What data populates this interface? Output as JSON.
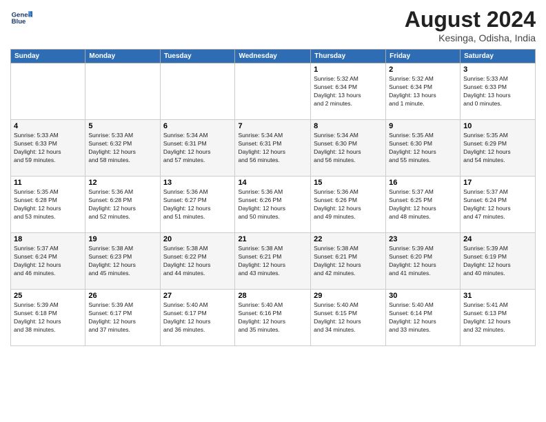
{
  "header": {
    "logo_line1": "General",
    "logo_line2": "Blue",
    "month": "August 2024",
    "location": "Kesinga, Odisha, India"
  },
  "days_of_week": [
    "Sunday",
    "Monday",
    "Tuesday",
    "Wednesday",
    "Thursday",
    "Friday",
    "Saturday"
  ],
  "weeks": [
    [
      {
        "day": "",
        "info": ""
      },
      {
        "day": "",
        "info": ""
      },
      {
        "day": "",
        "info": ""
      },
      {
        "day": "",
        "info": ""
      },
      {
        "day": "1",
        "info": "Sunrise: 5:32 AM\nSunset: 6:34 PM\nDaylight: 13 hours\nand 2 minutes."
      },
      {
        "day": "2",
        "info": "Sunrise: 5:32 AM\nSunset: 6:34 PM\nDaylight: 13 hours\nand 1 minute."
      },
      {
        "day": "3",
        "info": "Sunrise: 5:33 AM\nSunset: 6:33 PM\nDaylight: 13 hours\nand 0 minutes."
      }
    ],
    [
      {
        "day": "4",
        "info": "Sunrise: 5:33 AM\nSunset: 6:33 PM\nDaylight: 12 hours\nand 59 minutes."
      },
      {
        "day": "5",
        "info": "Sunrise: 5:33 AM\nSunset: 6:32 PM\nDaylight: 12 hours\nand 58 minutes."
      },
      {
        "day": "6",
        "info": "Sunrise: 5:34 AM\nSunset: 6:31 PM\nDaylight: 12 hours\nand 57 minutes."
      },
      {
        "day": "7",
        "info": "Sunrise: 5:34 AM\nSunset: 6:31 PM\nDaylight: 12 hours\nand 56 minutes."
      },
      {
        "day": "8",
        "info": "Sunrise: 5:34 AM\nSunset: 6:30 PM\nDaylight: 12 hours\nand 56 minutes."
      },
      {
        "day": "9",
        "info": "Sunrise: 5:35 AM\nSunset: 6:30 PM\nDaylight: 12 hours\nand 55 minutes."
      },
      {
        "day": "10",
        "info": "Sunrise: 5:35 AM\nSunset: 6:29 PM\nDaylight: 12 hours\nand 54 minutes."
      }
    ],
    [
      {
        "day": "11",
        "info": "Sunrise: 5:35 AM\nSunset: 6:28 PM\nDaylight: 12 hours\nand 53 minutes."
      },
      {
        "day": "12",
        "info": "Sunrise: 5:36 AM\nSunset: 6:28 PM\nDaylight: 12 hours\nand 52 minutes."
      },
      {
        "day": "13",
        "info": "Sunrise: 5:36 AM\nSunset: 6:27 PM\nDaylight: 12 hours\nand 51 minutes."
      },
      {
        "day": "14",
        "info": "Sunrise: 5:36 AM\nSunset: 6:26 PM\nDaylight: 12 hours\nand 50 minutes."
      },
      {
        "day": "15",
        "info": "Sunrise: 5:36 AM\nSunset: 6:26 PM\nDaylight: 12 hours\nand 49 minutes."
      },
      {
        "day": "16",
        "info": "Sunrise: 5:37 AM\nSunset: 6:25 PM\nDaylight: 12 hours\nand 48 minutes."
      },
      {
        "day": "17",
        "info": "Sunrise: 5:37 AM\nSunset: 6:24 PM\nDaylight: 12 hours\nand 47 minutes."
      }
    ],
    [
      {
        "day": "18",
        "info": "Sunrise: 5:37 AM\nSunset: 6:24 PM\nDaylight: 12 hours\nand 46 minutes."
      },
      {
        "day": "19",
        "info": "Sunrise: 5:38 AM\nSunset: 6:23 PM\nDaylight: 12 hours\nand 45 minutes."
      },
      {
        "day": "20",
        "info": "Sunrise: 5:38 AM\nSunset: 6:22 PM\nDaylight: 12 hours\nand 44 minutes."
      },
      {
        "day": "21",
        "info": "Sunrise: 5:38 AM\nSunset: 6:21 PM\nDaylight: 12 hours\nand 43 minutes."
      },
      {
        "day": "22",
        "info": "Sunrise: 5:38 AM\nSunset: 6:21 PM\nDaylight: 12 hours\nand 42 minutes."
      },
      {
        "day": "23",
        "info": "Sunrise: 5:39 AM\nSunset: 6:20 PM\nDaylight: 12 hours\nand 41 minutes."
      },
      {
        "day": "24",
        "info": "Sunrise: 5:39 AM\nSunset: 6:19 PM\nDaylight: 12 hours\nand 40 minutes."
      }
    ],
    [
      {
        "day": "25",
        "info": "Sunrise: 5:39 AM\nSunset: 6:18 PM\nDaylight: 12 hours\nand 38 minutes."
      },
      {
        "day": "26",
        "info": "Sunrise: 5:39 AM\nSunset: 6:17 PM\nDaylight: 12 hours\nand 37 minutes."
      },
      {
        "day": "27",
        "info": "Sunrise: 5:40 AM\nSunset: 6:17 PM\nDaylight: 12 hours\nand 36 minutes."
      },
      {
        "day": "28",
        "info": "Sunrise: 5:40 AM\nSunset: 6:16 PM\nDaylight: 12 hours\nand 35 minutes."
      },
      {
        "day": "29",
        "info": "Sunrise: 5:40 AM\nSunset: 6:15 PM\nDaylight: 12 hours\nand 34 minutes."
      },
      {
        "day": "30",
        "info": "Sunrise: 5:40 AM\nSunset: 6:14 PM\nDaylight: 12 hours\nand 33 minutes."
      },
      {
        "day": "31",
        "info": "Sunrise: 5:41 AM\nSunset: 6:13 PM\nDaylight: 12 hours\nand 32 minutes."
      }
    ]
  ]
}
